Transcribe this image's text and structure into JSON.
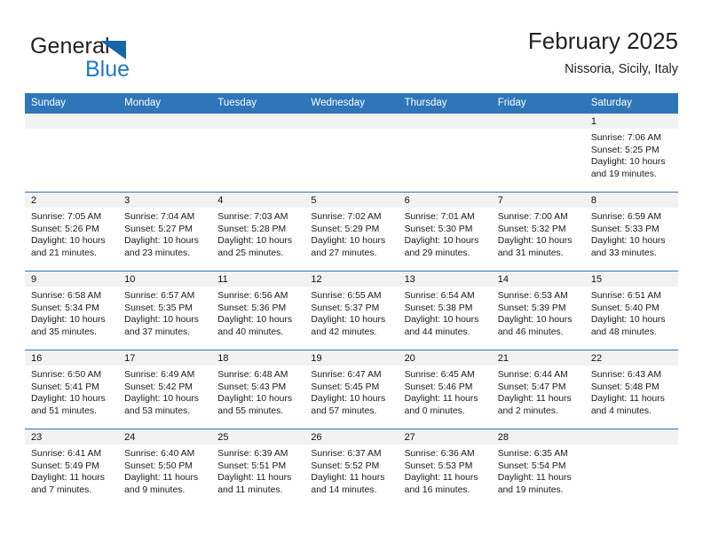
{
  "brand": {
    "name_part1": "General",
    "name_part2": "Blue",
    "accent_color": "#2079c8",
    "triangle_color": "#1566ab"
  },
  "header": {
    "title": "February 2025",
    "subtitle": "Nissoria, Sicily, Italy"
  },
  "calendar": {
    "header_bg": "#2e76b8",
    "weekdays": [
      "Sunday",
      "Monday",
      "Tuesday",
      "Wednesday",
      "Thursday",
      "Friday",
      "Saturday"
    ],
    "weeks": [
      [
        {
          "date": "",
          "lines": []
        },
        {
          "date": "",
          "lines": []
        },
        {
          "date": "",
          "lines": []
        },
        {
          "date": "",
          "lines": []
        },
        {
          "date": "",
          "lines": []
        },
        {
          "date": "",
          "lines": []
        },
        {
          "date": "1",
          "lines": [
            "Sunrise: 7:06 AM",
            "Sunset: 5:25 PM",
            "Daylight: 10 hours",
            "and 19 minutes."
          ]
        }
      ],
      [
        {
          "date": "2",
          "lines": [
            "Sunrise: 7:05 AM",
            "Sunset: 5:26 PM",
            "Daylight: 10 hours",
            "and 21 minutes."
          ]
        },
        {
          "date": "3",
          "lines": [
            "Sunrise: 7:04 AM",
            "Sunset: 5:27 PM",
            "Daylight: 10 hours",
            "and 23 minutes."
          ]
        },
        {
          "date": "4",
          "lines": [
            "Sunrise: 7:03 AM",
            "Sunset: 5:28 PM",
            "Daylight: 10 hours",
            "and 25 minutes."
          ]
        },
        {
          "date": "5",
          "lines": [
            "Sunrise: 7:02 AM",
            "Sunset: 5:29 PM",
            "Daylight: 10 hours",
            "and 27 minutes."
          ]
        },
        {
          "date": "6",
          "lines": [
            "Sunrise: 7:01 AM",
            "Sunset: 5:30 PM",
            "Daylight: 10 hours",
            "and 29 minutes."
          ]
        },
        {
          "date": "7",
          "lines": [
            "Sunrise: 7:00 AM",
            "Sunset: 5:32 PM",
            "Daylight: 10 hours",
            "and 31 minutes."
          ]
        },
        {
          "date": "8",
          "lines": [
            "Sunrise: 6:59 AM",
            "Sunset: 5:33 PM",
            "Daylight: 10 hours",
            "and 33 minutes."
          ]
        }
      ],
      [
        {
          "date": "9",
          "lines": [
            "Sunrise: 6:58 AM",
            "Sunset: 5:34 PM",
            "Daylight: 10 hours",
            "and 35 minutes."
          ]
        },
        {
          "date": "10",
          "lines": [
            "Sunrise: 6:57 AM",
            "Sunset: 5:35 PM",
            "Daylight: 10 hours",
            "and 37 minutes."
          ]
        },
        {
          "date": "11",
          "lines": [
            "Sunrise: 6:56 AM",
            "Sunset: 5:36 PM",
            "Daylight: 10 hours",
            "and 40 minutes."
          ]
        },
        {
          "date": "12",
          "lines": [
            "Sunrise: 6:55 AM",
            "Sunset: 5:37 PM",
            "Daylight: 10 hours",
            "and 42 minutes."
          ]
        },
        {
          "date": "13",
          "lines": [
            "Sunrise: 6:54 AM",
            "Sunset: 5:38 PM",
            "Daylight: 10 hours",
            "and 44 minutes."
          ]
        },
        {
          "date": "14",
          "lines": [
            "Sunrise: 6:53 AM",
            "Sunset: 5:39 PM",
            "Daylight: 10 hours",
            "and 46 minutes."
          ]
        },
        {
          "date": "15",
          "lines": [
            "Sunrise: 6:51 AM",
            "Sunset: 5:40 PM",
            "Daylight: 10 hours",
            "and 48 minutes."
          ]
        }
      ],
      [
        {
          "date": "16",
          "lines": [
            "Sunrise: 6:50 AM",
            "Sunset: 5:41 PM",
            "Daylight: 10 hours",
            "and 51 minutes."
          ]
        },
        {
          "date": "17",
          "lines": [
            "Sunrise: 6:49 AM",
            "Sunset: 5:42 PM",
            "Daylight: 10 hours",
            "and 53 minutes."
          ]
        },
        {
          "date": "18",
          "lines": [
            "Sunrise: 6:48 AM",
            "Sunset: 5:43 PM",
            "Daylight: 10 hours",
            "and 55 minutes."
          ]
        },
        {
          "date": "19",
          "lines": [
            "Sunrise: 6:47 AM",
            "Sunset: 5:45 PM",
            "Daylight: 10 hours",
            "and 57 minutes."
          ]
        },
        {
          "date": "20",
          "lines": [
            "Sunrise: 6:45 AM",
            "Sunset: 5:46 PM",
            "Daylight: 11 hours",
            "and 0 minutes."
          ]
        },
        {
          "date": "21",
          "lines": [
            "Sunrise: 6:44 AM",
            "Sunset: 5:47 PM",
            "Daylight: 11 hours",
            "and 2 minutes."
          ]
        },
        {
          "date": "22",
          "lines": [
            "Sunrise: 6:43 AM",
            "Sunset: 5:48 PM",
            "Daylight: 11 hours",
            "and 4 minutes."
          ]
        }
      ],
      [
        {
          "date": "23",
          "lines": [
            "Sunrise: 6:41 AM",
            "Sunset: 5:49 PM",
            "Daylight: 11 hours",
            "and 7 minutes."
          ]
        },
        {
          "date": "24",
          "lines": [
            "Sunrise: 6:40 AM",
            "Sunset: 5:50 PM",
            "Daylight: 11 hours",
            "and 9 minutes."
          ]
        },
        {
          "date": "25",
          "lines": [
            "Sunrise: 6:39 AM",
            "Sunset: 5:51 PM",
            "Daylight: 11 hours",
            "and 11 minutes."
          ]
        },
        {
          "date": "26",
          "lines": [
            "Sunrise: 6:37 AM",
            "Sunset: 5:52 PM",
            "Daylight: 11 hours",
            "and 14 minutes."
          ]
        },
        {
          "date": "27",
          "lines": [
            "Sunrise: 6:36 AM",
            "Sunset: 5:53 PM",
            "Daylight: 11 hours",
            "and 16 minutes."
          ]
        },
        {
          "date": "28",
          "lines": [
            "Sunrise: 6:35 AM",
            "Sunset: 5:54 PM",
            "Daylight: 11 hours",
            "and 19 minutes."
          ]
        },
        {
          "date": "",
          "lines": []
        }
      ]
    ]
  }
}
